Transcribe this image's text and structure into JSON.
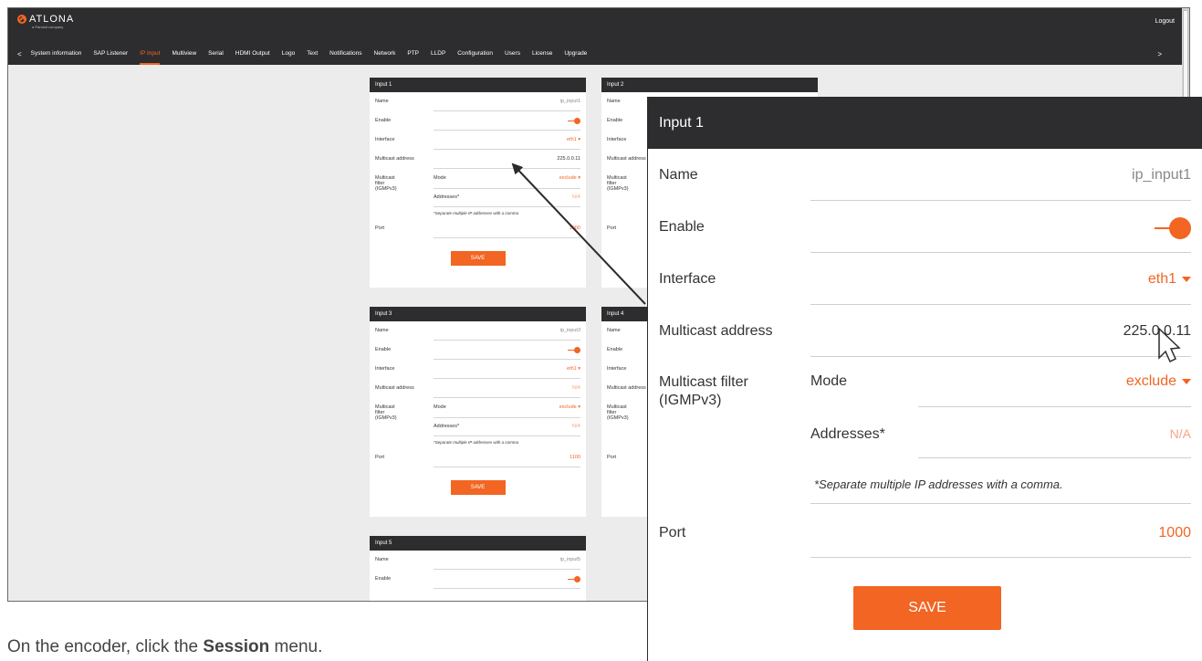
{
  "logo": {
    "name": "ATLONA",
    "sub": "a Panduit company"
  },
  "header": {
    "logout": "Logout"
  },
  "nav": {
    "tabs": [
      "System information",
      "SAP Listener",
      "IP Input",
      "Multiview",
      "Serial",
      "HDMI Output",
      "Logo",
      "Text",
      "Notifications",
      "Network",
      "PTP",
      "LLDP",
      "Configuration",
      "Users",
      "License",
      "Upgrade"
    ],
    "active": "IP Input",
    "prev": "<",
    "next": ">"
  },
  "labels": {
    "name": "Name",
    "enable": "Enable",
    "interface": "Interface",
    "multicast_address": "Multicast address",
    "multicast_filter": "Multicast filter (IGMPv3)",
    "mode": "Mode",
    "addresses": "Addresses*",
    "note": "*Separate multiple IP addresses with a comma",
    "port": "Port",
    "save": "SAVE"
  },
  "inputs": [
    {
      "title": "Input 1",
      "name": "ip_input1",
      "enabled": true,
      "interface": "eth1",
      "multicast_address": "225.0.0.11",
      "mode": "exclude",
      "addresses": "N/A",
      "port": "1000"
    },
    {
      "title": "Input 2"
    },
    {
      "title": "Input 3",
      "name": "ip_input3",
      "enabled": true,
      "interface": "eth1",
      "multicast_address": "N/A",
      "mode": "exclude",
      "addresses": "N/A",
      "port": "1100"
    },
    {
      "title": "Input 4"
    },
    {
      "title": "Input 5",
      "name": "ip_input5",
      "enabled": true
    }
  ],
  "zoom": {
    "title": "Input 1",
    "name": "ip_input1",
    "interface": "eth1",
    "multicast_address": "225.0.0.11",
    "mode": "exclude",
    "addresses": "N/A",
    "note": "*Separate multiple IP addresses with a comma.",
    "port": "1000",
    "save": "SAVE"
  },
  "caption": {
    "before": "On the encoder, click the ",
    "bold": "Session",
    "after": " menu."
  },
  "colors": {
    "accent": "#f26522",
    "header": "#2d2d2f",
    "background": "#ececec"
  }
}
